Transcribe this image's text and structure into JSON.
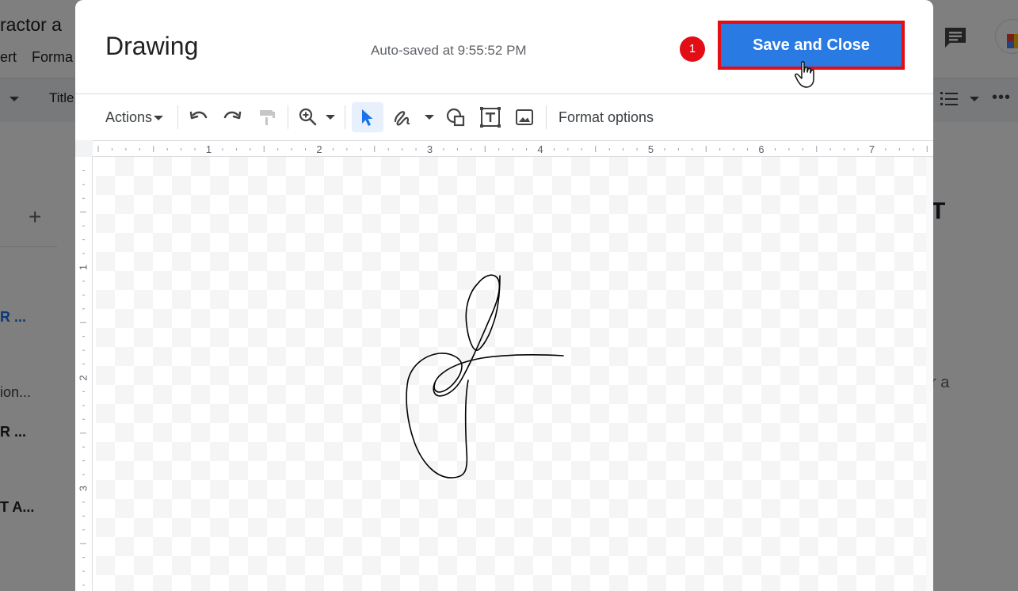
{
  "background_doc": {
    "title_fragment": "ractor a",
    "menu_items": [
      "ert",
      "Forma"
    ],
    "style_select": "Title",
    "outline_items": [
      {
        "text": "R ...",
        "color": "#1a73e8"
      },
      {
        "text": "ion...",
        "color": "#3c4043"
      },
      {
        "text": "R ...",
        "color": "#202124"
      },
      {
        "text": "T A...",
        "color": "#202124"
      }
    ],
    "right_heading_fragment": "T",
    "right_text_fragment": "r a"
  },
  "dialog": {
    "title": "Drawing",
    "autosave_text": "Auto-saved at 9:55:52 PM",
    "save_button_label": "Save and Close",
    "step_badge": "1",
    "toolbar": {
      "actions_label": "Actions",
      "format_options_label": "Format options",
      "icons": [
        "undo-icon",
        "redo-icon",
        "paint-format-icon",
        "zoom-icon",
        "select-icon",
        "scribble-icon",
        "shape-icon",
        "text-box-icon",
        "image-icon"
      ]
    },
    "ruler": {
      "horizontal_labels": [
        "1",
        "2",
        "3",
        "4",
        "5",
        "6",
        "7"
      ],
      "vertical_labels": [
        "1",
        "2",
        "3"
      ]
    }
  },
  "colors": {
    "save_button": "#2a7ae4",
    "highlight": "#e30d16",
    "selected_tool_bg": "#e8f0fe",
    "selected_tool_icon": "#1a73e8"
  }
}
